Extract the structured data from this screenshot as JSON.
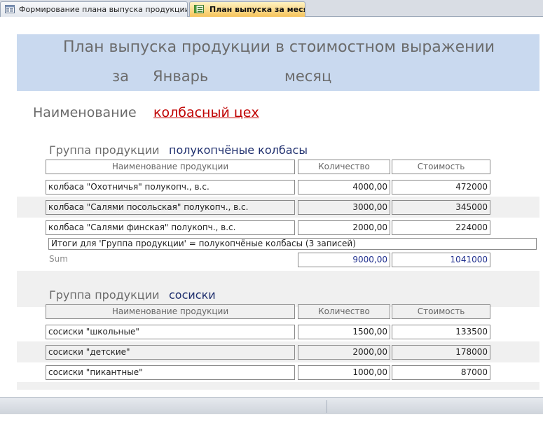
{
  "tabs": [
    {
      "label": "Формирование плана выпуска продукции",
      "active": false,
      "icon": "form-icon"
    },
    {
      "label": "План выпуска за месяц",
      "active": true,
      "icon": "report-icon"
    }
  ],
  "header": {
    "title": "План выпуска продукции в стоимостном выражении",
    "za": "за",
    "month": "Январь",
    "mesyac": "месяц"
  },
  "name": {
    "label": "Наименование",
    "value": "колбасный цех"
  },
  "columns": {
    "name": "Наименование продукции",
    "qty": "Количество",
    "cost": "Стоимость"
  },
  "groups": [
    {
      "label": "Группа продукции",
      "value": "полукопчёные колбасы",
      "rows": [
        {
          "name": "колбаса \"Охотничья\" полукопч., в.с.",
          "qty": "4000,00",
          "cost": "472000"
        },
        {
          "name": "колбаса \"Салями посольская\" полукопч., в.с.",
          "qty": "3000,00",
          "cost": "345000"
        },
        {
          "name": "колбаса \"Салями финская\" полукопч., в.с.",
          "qty": "2000,00",
          "cost": "224000"
        }
      ],
      "totals_text": "Итоги для 'Группа продукции' =  полукопчёные колбасы (3 записей)",
      "sum_label": "Sum",
      "sum_qty": "9000,00",
      "sum_cost": "1041000"
    },
    {
      "label": "Группа продукции",
      "value": "сосиски",
      "rows": [
        {
          "name": "сосиски \"школьные\"",
          "qty": "1500,00",
          "cost": "133500"
        },
        {
          "name": "сосиски \"детские\"",
          "qty": "2000,00",
          "cost": "178000"
        },
        {
          "name": "сосиски \"пикантные\"",
          "qty": "1000,00",
          "cost": "87000"
        }
      ]
    }
  ],
  "colors": {
    "header_band": "#c9d9ef",
    "name_value": "#c00000",
    "group_value": "#1f2f6e",
    "active_tab": "#f6c35b"
  }
}
